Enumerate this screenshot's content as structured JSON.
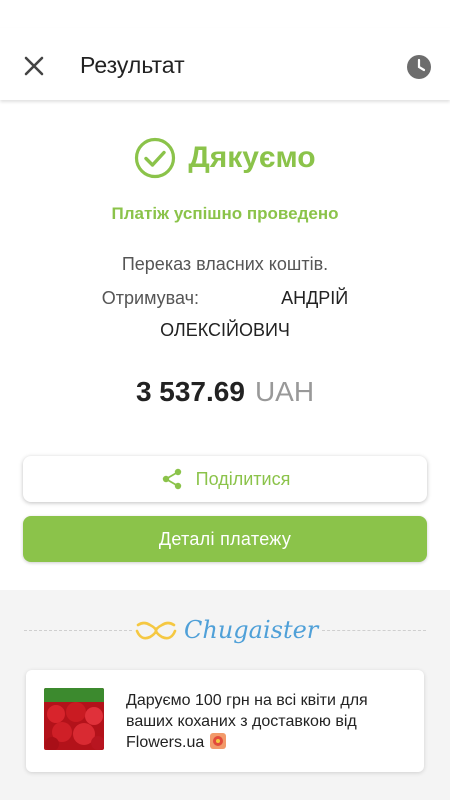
{
  "header": {
    "title": "Результат",
    "close_icon": "close-icon",
    "history_icon": "clock-icon"
  },
  "result": {
    "title": "Дякуємо",
    "subtitle": "Платіж успішно проведено",
    "transfer_type": "Переказ власних коштів.",
    "recipient_label": "Отримувач:",
    "recipient_name_line1": "АНДРІЙ",
    "recipient_name_line2": "ОЛЕКСІЙОВИЧ",
    "amount": "3 537.69",
    "currency": "UAH"
  },
  "actions": {
    "share_label": "Поділитися",
    "details_label": "Деталі платежу"
  },
  "promo": {
    "brand": "Chugaister",
    "text": "Даруємо 100 грн на всі квіти для ваших коханих з доставкою від Flowers.ua"
  },
  "colors": {
    "accent": "#8bc34a",
    "brand_blue": "#4fa0d8",
    "brand_yellow": "#f5c842"
  }
}
